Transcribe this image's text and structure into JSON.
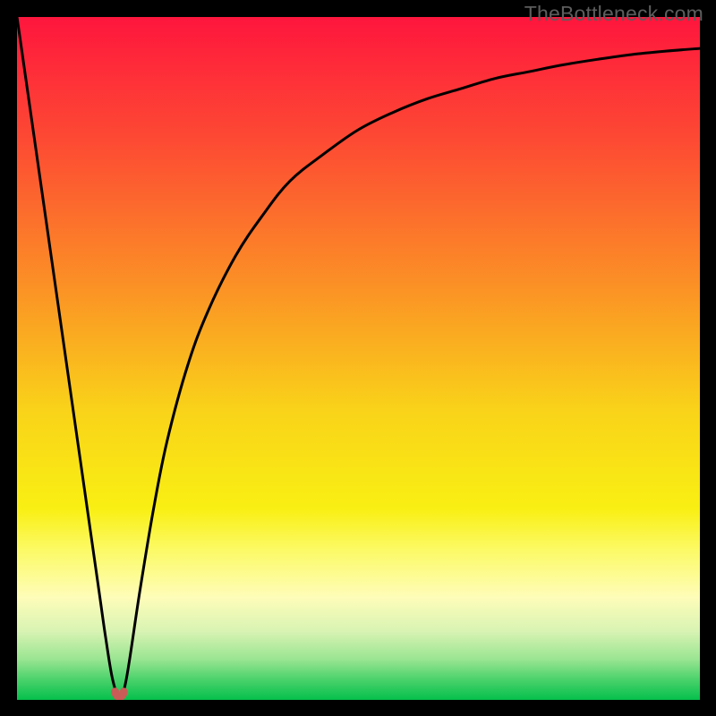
{
  "watermark": "TheBottleneck.com",
  "chart_data": {
    "type": "line",
    "title": "",
    "xlabel": "",
    "ylabel": "",
    "xlim": [
      0,
      100
    ],
    "ylim": [
      0,
      100
    ],
    "series": [
      {
        "name": "bottleneck-curve",
        "x": [
          0,
          2,
          4,
          6,
          8,
          10,
          12,
          13,
          14,
          15,
          16,
          18,
          20,
          22,
          25,
          28,
          32,
          36,
          40,
          45,
          50,
          55,
          60,
          65,
          70,
          75,
          80,
          85,
          90,
          95,
          100
        ],
        "values": [
          100,
          86,
          72,
          58,
          44,
          30,
          16,
          9,
          3,
          0.5,
          3,
          16,
          28,
          38,
          49,
          57,
          65,
          71,
          76,
          80,
          83.5,
          86,
          88,
          89.5,
          91,
          92,
          93,
          93.8,
          94.5,
          95,
          95.4
        ]
      }
    ],
    "minimum_marker": {
      "x": 15,
      "y": 0.5,
      "color": "#c95c56"
    },
    "background": {
      "type": "vertical-gradient",
      "stops": [
        {
          "pct": 0,
          "color": "#fe163d"
        },
        {
          "pct": 20,
          "color": "#fd5032"
        },
        {
          "pct": 40,
          "color": "#fb9325"
        },
        {
          "pct": 58,
          "color": "#f9d419"
        },
        {
          "pct": 72,
          "color": "#f9ef13"
        },
        {
          "pct": 78,
          "color": "#fcfa65"
        },
        {
          "pct": 85,
          "color": "#fefdb9"
        },
        {
          "pct": 90,
          "color": "#d8f3b3"
        },
        {
          "pct": 94,
          "color": "#9be592"
        },
        {
          "pct": 97,
          "color": "#4bd26b"
        },
        {
          "pct": 100,
          "color": "#05c04c"
        }
      ]
    }
  }
}
